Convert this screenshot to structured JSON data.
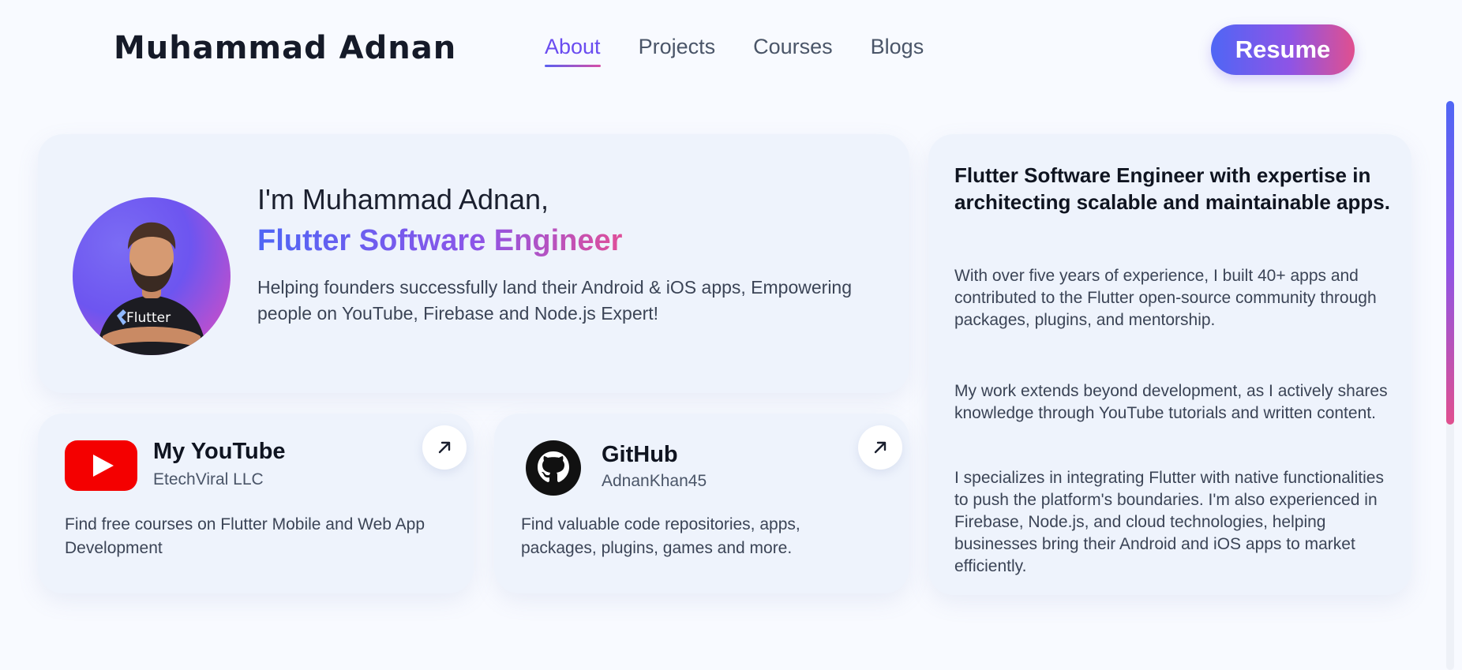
{
  "header": {
    "brand": "Muhammad Adnan",
    "nav": [
      {
        "label": "About",
        "active": true
      },
      {
        "label": "Projects",
        "active": false
      },
      {
        "label": "Courses",
        "active": false
      },
      {
        "label": "Blogs",
        "active": false
      }
    ],
    "resume_label": "Resume"
  },
  "hero": {
    "intro": "I'm Muhammad Adnan,",
    "role": "Flutter Software Engineer",
    "description": "Helping founders successfully land their Android & iOS apps, Empowering people on YouTube, Firebase and Node.js Expert!",
    "avatar_shirt_text": "Flutter"
  },
  "about": {
    "heading": "Flutter Software Engineer with expertise in architecting scalable and maintainable apps.",
    "paragraphs": [
      "With over five years of experience, I built 40+ apps and contributed to the Flutter open-source community through packages, plugins, and mentorship.",
      "My work extends beyond development, as I actively shares knowledge through YouTube tutorials and written content.",
      "I specializes in integrating Flutter with native functionalities to push the platform's boundaries. I'm also experienced in Firebase, Node.js, and cloud technologies, helping businesses bring their Android and iOS apps to market efficiently."
    ]
  },
  "youtube": {
    "title": "My YouTube",
    "subtitle": "EtechViral LLC",
    "description": "Find free courses on Flutter Mobile and Web App Development",
    "icon": "youtube-logo-icon"
  },
  "github": {
    "title": "GitHub",
    "subtitle": "AdnanKhan45",
    "description": "Find valuable code repositories, apps, packages, plugins, games and more.",
    "icon": "github-logo-icon"
  },
  "colors": {
    "accent_start": "#4f66f5",
    "accent_end": "#e0508f",
    "card_bg": "#eef3fc",
    "youtube_red": "#f40000"
  }
}
